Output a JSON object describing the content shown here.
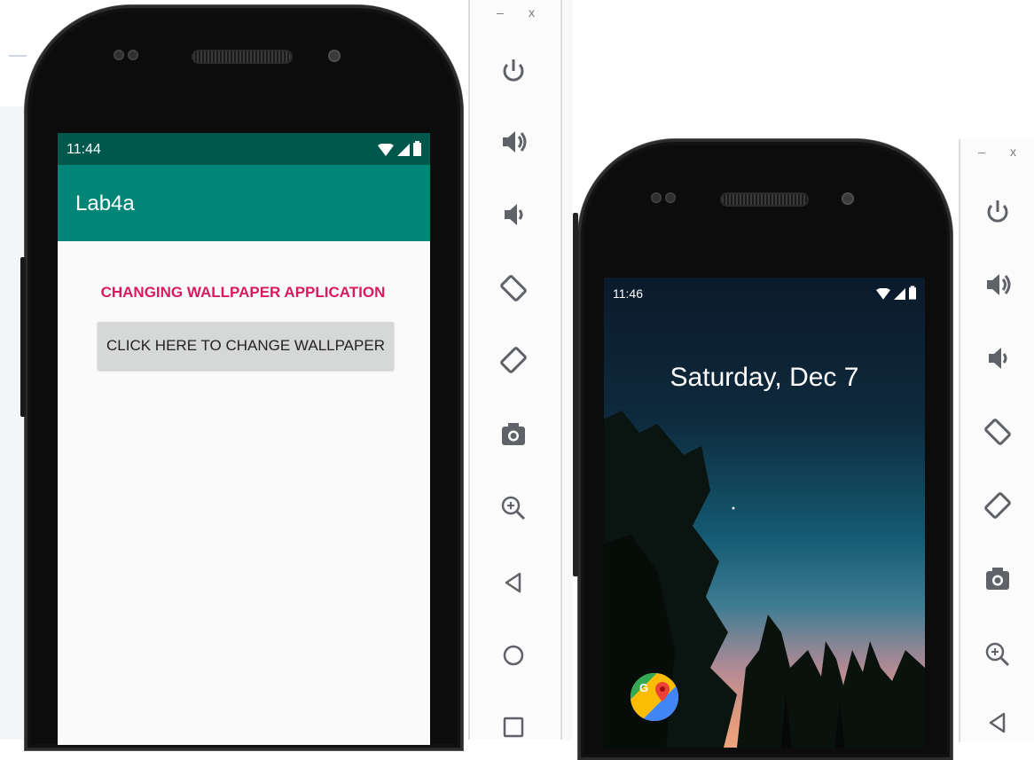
{
  "emulator_left": {
    "status_time": "11:44",
    "app_title": "Lab4a",
    "heading": "CHANGING WALLPAPER APPLICATION",
    "button_label": "CLICK HERE TO CHANGE WALLPAPER"
  },
  "emulator_right": {
    "status_time": "11:46",
    "date": "Saturday, Dec 7",
    "maps_glyph": "G"
  },
  "toolbar_left": {
    "minimize": "–",
    "close": "x",
    "tools": [
      "power-icon",
      "volume-up-icon",
      "volume-down-icon",
      "rotate-left-icon",
      "rotate-right-icon",
      "camera-icon",
      "zoom-icon",
      "back-icon",
      "home-icon",
      "overview-icon"
    ]
  },
  "toolbar_right": {
    "minimize": "–",
    "close": "x",
    "tools": [
      "power-icon",
      "volume-up-icon",
      "volume-down-icon",
      "rotate-left-icon",
      "rotate-right-icon",
      "camera-icon",
      "zoom-icon",
      "back-icon"
    ]
  },
  "colors": {
    "primary": "#008577",
    "primary_dark": "#00574B",
    "accent": "#D81B60",
    "app_background": "#FAFAFA",
    "button_bg": "#D6D7D7",
    "toolbar_icon": "#5f6368"
  }
}
